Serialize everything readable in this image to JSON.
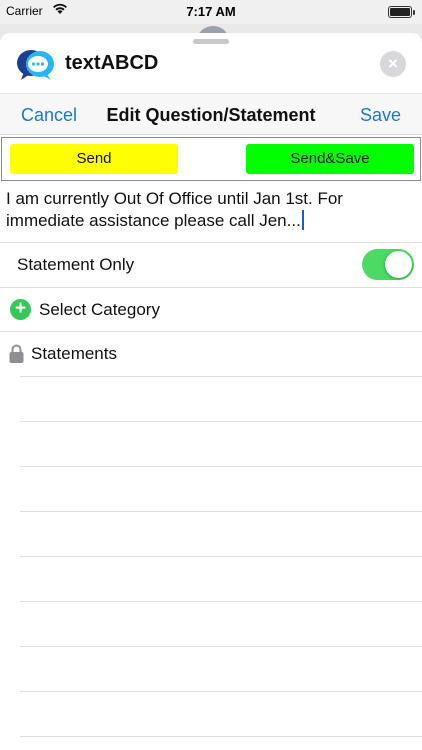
{
  "status_bar": {
    "carrier": "Carrier",
    "time": "7:17 AM"
  },
  "app": {
    "name": "textABCD"
  },
  "nav": {
    "cancel_label": "Cancel",
    "title": "Edit Question/Statement",
    "save_label": "Save"
  },
  "actions": {
    "send_label": "Send",
    "send_color": "#ffff00",
    "send_save_label": "Send&Save",
    "send_save_color": "#00ff00"
  },
  "message": {
    "text": "I am currently Out Of Office until Jan 1st. For immediate assistance please call Jen..."
  },
  "statement_only": {
    "label": "Statement Only",
    "on": true
  },
  "category": {
    "label": "Select Category"
  },
  "statements": {
    "label": "Statements"
  },
  "colors": {
    "accent": "#1a76d2",
    "toggle_on": "#4cd964",
    "plus_green": "#35c759"
  }
}
